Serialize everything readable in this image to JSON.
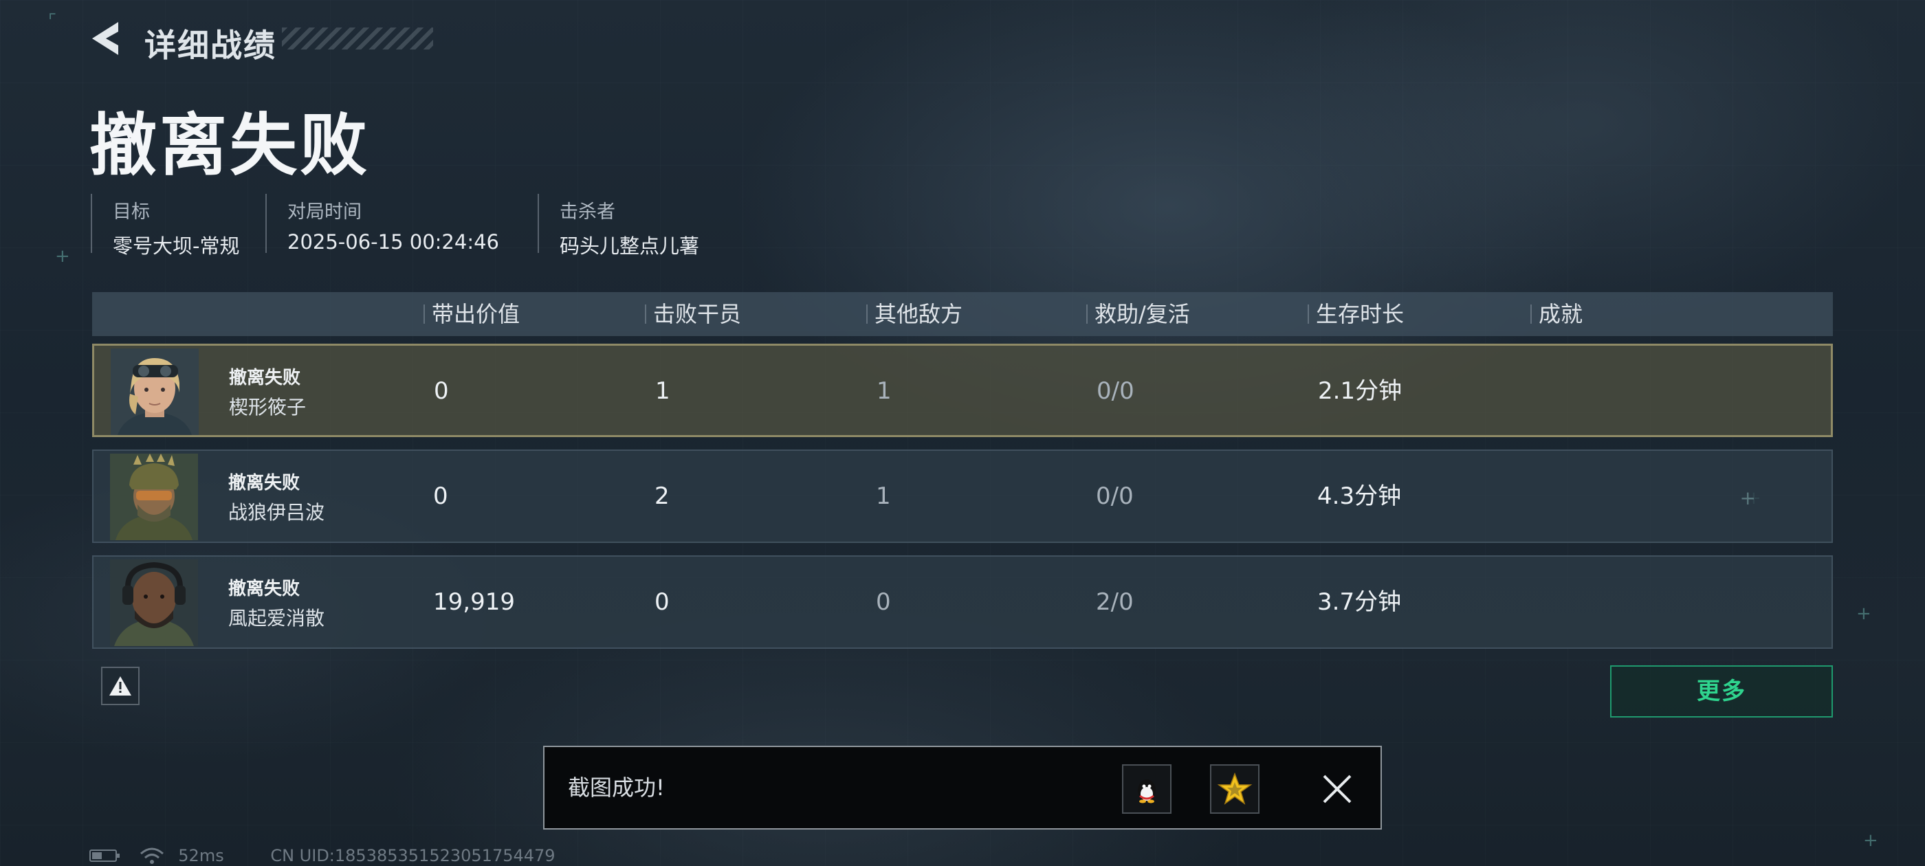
{
  "header": {
    "title": "详细战绩"
  },
  "main": {
    "title": "撤离失败"
  },
  "info": [
    {
      "label": "目标",
      "value": "零号大坝-常规"
    },
    {
      "label": "对局时间",
      "value": "2025-06-15 00:24:46"
    },
    {
      "label": "击杀者",
      "value": "码头儿整点儿薯"
    }
  ],
  "table": {
    "columns": [
      "带出价值",
      "击败干员",
      "其他敌方",
      "救助/复活",
      "生存时长",
      "成就"
    ],
    "rows": [
      {
        "status": "撤离失败",
        "name": "楔形筱子",
        "value": "0",
        "kills": "1",
        "other": "1",
        "assist": "0/0",
        "time": "2.1分钟",
        "achievement": ""
      },
      {
        "status": "撤离失败",
        "name": "战狼伊吕波",
        "value": "0",
        "kills": "2",
        "other": "1",
        "assist": "0/0",
        "time": "4.3分钟",
        "achievement": ""
      },
      {
        "status": "撤离失败",
        "name": "風起爱消散",
        "value": "19,919",
        "kills": "0",
        "other": "0",
        "assist": "2/0",
        "time": "3.7分钟",
        "achievement": ""
      }
    ]
  },
  "buttons": {
    "more": "更多"
  },
  "toast": {
    "text": "截图成功!"
  },
  "status_bar": {
    "ping": "52ms",
    "uid": "CN UID:185385351523051754479"
  },
  "icons": [
    "back-arrow-icon",
    "warning-icon",
    "qq-icon",
    "star-icon",
    "close-icon",
    "battery-icon",
    "wifi-icon"
  ],
  "colors": {
    "accent": "#2fd48e",
    "selected_border": "#8f8a66",
    "background": "#1d2832"
  }
}
